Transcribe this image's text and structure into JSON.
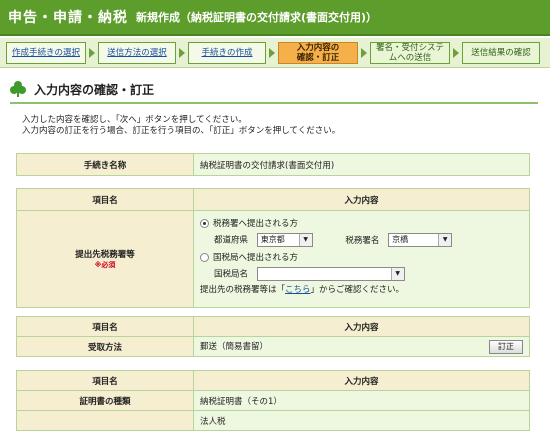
{
  "header": {
    "title": "申告・申請・納税",
    "subtitle": "新規作成（納税証明書の交付請求(書面交付用)）"
  },
  "steps": [
    {
      "l1": "作成手続きの選択",
      "l2": ""
    },
    {
      "l1": "送信方法の選択",
      "l2": ""
    },
    {
      "l1": "手続きの作成",
      "l2": ""
    },
    {
      "l1": "入力内容の",
      "l2": "確認・訂正"
    },
    {
      "l1": "署名・受付システ",
      "l2": "ムへの送信"
    },
    {
      "l1": "送信結果の確認",
      "l2": ""
    }
  ],
  "page": {
    "title": "入力内容の確認・訂正",
    "intro1": "入力した内容を確認し、「次へ」ボタンを押してください。",
    "intro2": "入力内容の訂正を行う場合、訂正を行う項目の、「訂正」ボタンを押してください。"
  },
  "proc": {
    "label": "手続き名称",
    "value": "納税証明書の交付請求(書面交付用)"
  },
  "tax": {
    "h1": "項目名",
    "h2": "入力内容",
    "label": "提出先税務署等",
    "required": "※必須",
    "opt1": "税務署へ提出される方",
    "pref_label": "都道府県",
    "pref": "東京都",
    "office_label": "税務署名",
    "office": "京橋",
    "opt2": "国税局へ提出される方",
    "bureau_label": "国税局名",
    "bureau": "",
    "note_a": "提出先の税務署等は「",
    "note_link": "こちら",
    "note_b": "」からご確認ください。"
  },
  "receive": {
    "h1": "項目名",
    "h2": "入力内容",
    "label": "受取方法",
    "value": "郵送（簡易書留）",
    "fix": "訂正"
  },
  "cert": {
    "h1": "項目名",
    "h2": "入力内容",
    "label": "証明書の種類",
    "value": "納税証明書（その1）",
    "extra": "法人税"
  }
}
